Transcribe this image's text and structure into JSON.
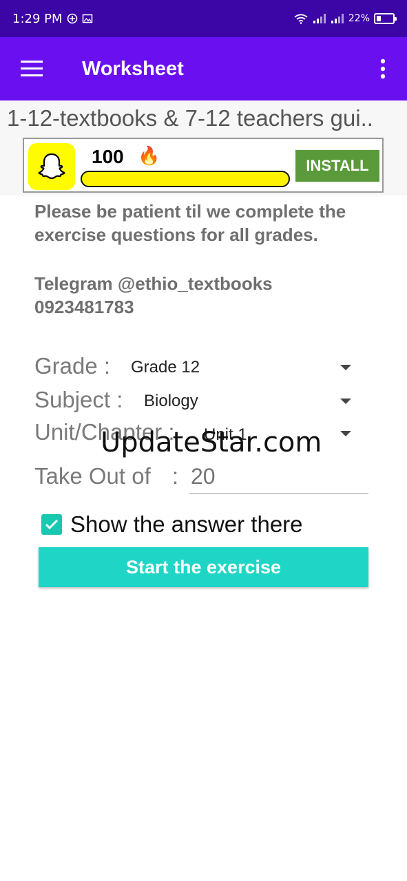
{
  "status_bar": {
    "time": "1:29 PM",
    "battery": "22%",
    "battery_level": 0.22
  },
  "app_bar": {
    "title": "Worksheet"
  },
  "marquee": {
    "text": "1-12-textbooks & 7-12 teachers gui.."
  },
  "ad": {
    "score": "100",
    "fire": "🔥",
    "install_label": "INSTALL",
    "logo_color": "#fffc00"
  },
  "content": {
    "notice": "Please be patient til we complete the exercise questions for all grades.",
    "contact_telegram": "Telegram @ethio_textbooks",
    "contact_phone": "0923481783"
  },
  "form": {
    "grade_label": "Grade :",
    "grade_value": "Grade 12",
    "subject_label": "Subject :",
    "subject_value": "Biology",
    "unit_label": "Unit/Chapter :",
    "unit_value": "Unit 1",
    "takeout_label": "Take Out of",
    "takeout_colon": ":",
    "takeout_placeholder": "20",
    "show_answer_label": "Show the answer there",
    "show_answer_checked": true,
    "start_button": "Start the exercise"
  },
  "watermark": "UpdateStar.com",
  "colors": {
    "status_bar": "#3c05a6",
    "app_bar": "#6a10f0",
    "accent": "#1fd6c6",
    "install": "#5a9a3a"
  }
}
